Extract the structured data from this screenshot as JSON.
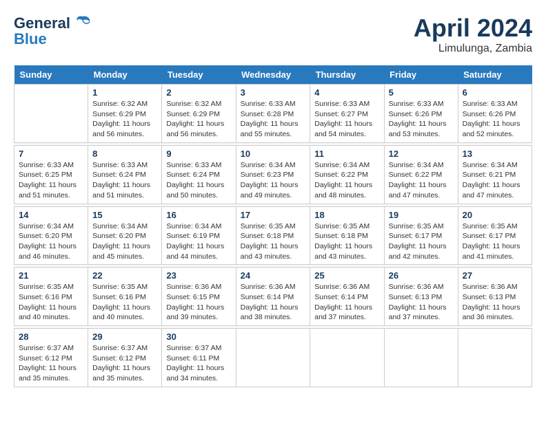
{
  "logo": {
    "general": "General",
    "blue": "Blue"
  },
  "header": {
    "title": "April 2024",
    "subtitle": "Limulunga, Zambia"
  },
  "weekdays": [
    "Sunday",
    "Monday",
    "Tuesday",
    "Wednesday",
    "Thursday",
    "Friday",
    "Saturday"
  ],
  "weeks": [
    [
      {
        "day": "",
        "info": ""
      },
      {
        "day": "1",
        "info": "Sunrise: 6:32 AM\nSunset: 6:29 PM\nDaylight: 11 hours\nand 56 minutes."
      },
      {
        "day": "2",
        "info": "Sunrise: 6:32 AM\nSunset: 6:29 PM\nDaylight: 11 hours\nand 56 minutes."
      },
      {
        "day": "3",
        "info": "Sunrise: 6:33 AM\nSunset: 6:28 PM\nDaylight: 11 hours\nand 55 minutes."
      },
      {
        "day": "4",
        "info": "Sunrise: 6:33 AM\nSunset: 6:27 PM\nDaylight: 11 hours\nand 54 minutes."
      },
      {
        "day": "5",
        "info": "Sunrise: 6:33 AM\nSunset: 6:26 PM\nDaylight: 11 hours\nand 53 minutes."
      },
      {
        "day": "6",
        "info": "Sunrise: 6:33 AM\nSunset: 6:26 PM\nDaylight: 11 hours\nand 52 minutes."
      }
    ],
    [
      {
        "day": "7",
        "info": "Sunrise: 6:33 AM\nSunset: 6:25 PM\nDaylight: 11 hours\nand 51 minutes."
      },
      {
        "day": "8",
        "info": "Sunrise: 6:33 AM\nSunset: 6:24 PM\nDaylight: 11 hours\nand 51 minutes."
      },
      {
        "day": "9",
        "info": "Sunrise: 6:33 AM\nSunset: 6:24 PM\nDaylight: 11 hours\nand 50 minutes."
      },
      {
        "day": "10",
        "info": "Sunrise: 6:34 AM\nSunset: 6:23 PM\nDaylight: 11 hours\nand 49 minutes."
      },
      {
        "day": "11",
        "info": "Sunrise: 6:34 AM\nSunset: 6:22 PM\nDaylight: 11 hours\nand 48 minutes."
      },
      {
        "day": "12",
        "info": "Sunrise: 6:34 AM\nSunset: 6:22 PM\nDaylight: 11 hours\nand 47 minutes."
      },
      {
        "day": "13",
        "info": "Sunrise: 6:34 AM\nSunset: 6:21 PM\nDaylight: 11 hours\nand 47 minutes."
      }
    ],
    [
      {
        "day": "14",
        "info": "Sunrise: 6:34 AM\nSunset: 6:20 PM\nDaylight: 11 hours\nand 46 minutes."
      },
      {
        "day": "15",
        "info": "Sunrise: 6:34 AM\nSunset: 6:20 PM\nDaylight: 11 hours\nand 45 minutes."
      },
      {
        "day": "16",
        "info": "Sunrise: 6:34 AM\nSunset: 6:19 PM\nDaylight: 11 hours\nand 44 minutes."
      },
      {
        "day": "17",
        "info": "Sunrise: 6:35 AM\nSunset: 6:18 PM\nDaylight: 11 hours\nand 43 minutes."
      },
      {
        "day": "18",
        "info": "Sunrise: 6:35 AM\nSunset: 6:18 PM\nDaylight: 11 hours\nand 43 minutes."
      },
      {
        "day": "19",
        "info": "Sunrise: 6:35 AM\nSunset: 6:17 PM\nDaylight: 11 hours\nand 42 minutes."
      },
      {
        "day": "20",
        "info": "Sunrise: 6:35 AM\nSunset: 6:17 PM\nDaylight: 11 hours\nand 41 minutes."
      }
    ],
    [
      {
        "day": "21",
        "info": "Sunrise: 6:35 AM\nSunset: 6:16 PM\nDaylight: 11 hours\nand 40 minutes."
      },
      {
        "day": "22",
        "info": "Sunrise: 6:35 AM\nSunset: 6:16 PM\nDaylight: 11 hours\nand 40 minutes."
      },
      {
        "day": "23",
        "info": "Sunrise: 6:36 AM\nSunset: 6:15 PM\nDaylight: 11 hours\nand 39 minutes."
      },
      {
        "day": "24",
        "info": "Sunrise: 6:36 AM\nSunset: 6:14 PM\nDaylight: 11 hours\nand 38 minutes."
      },
      {
        "day": "25",
        "info": "Sunrise: 6:36 AM\nSunset: 6:14 PM\nDaylight: 11 hours\nand 37 minutes."
      },
      {
        "day": "26",
        "info": "Sunrise: 6:36 AM\nSunset: 6:13 PM\nDaylight: 11 hours\nand 37 minutes."
      },
      {
        "day": "27",
        "info": "Sunrise: 6:36 AM\nSunset: 6:13 PM\nDaylight: 11 hours\nand 36 minutes."
      }
    ],
    [
      {
        "day": "28",
        "info": "Sunrise: 6:37 AM\nSunset: 6:12 PM\nDaylight: 11 hours\nand 35 minutes."
      },
      {
        "day": "29",
        "info": "Sunrise: 6:37 AM\nSunset: 6:12 PM\nDaylight: 11 hours\nand 35 minutes."
      },
      {
        "day": "30",
        "info": "Sunrise: 6:37 AM\nSunset: 6:11 PM\nDaylight: 11 hours\nand 34 minutes."
      },
      {
        "day": "",
        "info": ""
      },
      {
        "day": "",
        "info": ""
      },
      {
        "day": "",
        "info": ""
      },
      {
        "day": "",
        "info": ""
      }
    ]
  ]
}
